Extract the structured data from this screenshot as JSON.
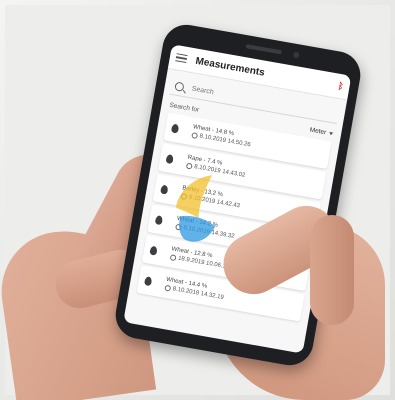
{
  "app": {
    "title": "Measurements",
    "search_placeholder": "Search",
    "filter_label": "Search for",
    "filter_value": "Meter"
  },
  "measurements": [
    {
      "label": "Wheat - 14.8 %",
      "timestamp": "8.10.2019 14.50.26"
    },
    {
      "label": "Rape - 7.4 %",
      "timestamp": "8.10.2019 14.43.02"
    },
    {
      "label": "Barley - 13.2 %",
      "timestamp": "8.10.2019 14.42.43"
    },
    {
      "label": "Wheat - 14.2 %",
      "timestamp": "8.10.2019 14.39.32"
    },
    {
      "label": "Wheat - 12.8 %",
      "timestamp": "18.9.2019 10.06.17"
    },
    {
      "label": "Wheat - 14.4 %",
      "timestamp": "8.10.2019 14.32.19"
    }
  ],
  "icons": {
    "menu": "menu-icon",
    "status": "bluetooth-icon",
    "search": "search-icon",
    "item": "droplet-icon",
    "time": "clock-icon"
  },
  "colors": {
    "accent_red": "#e0403a",
    "logo_yellow": "#f2c230",
    "logo_blue": "#2f9ae0"
  }
}
